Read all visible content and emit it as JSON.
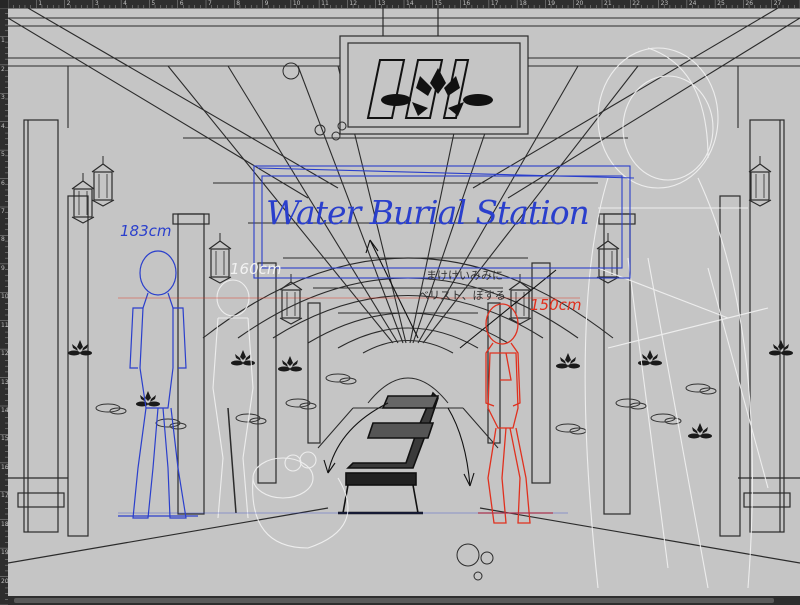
{
  "ruler": {
    "top_labels": [
      "1",
      "2",
      "3",
      "4",
      "5",
      "6",
      "7",
      "8",
      "9",
      "10",
      "11",
      "12",
      "13",
      "14",
      "15",
      "16",
      "17",
      "18",
      "19",
      "20",
      "21",
      "22",
      "23",
      "24",
      "25",
      "26",
      "27"
    ],
    "left_labels": [
      "1",
      "2",
      "3",
      "4",
      "5",
      "6",
      "7",
      "8",
      "9",
      "10",
      "11",
      "12",
      "13",
      "14",
      "15",
      "16",
      "17",
      "18",
      "19",
      "20"
    ]
  },
  "annotations": {
    "station_name": "Water Burial Station",
    "height_blue": "183cm",
    "height_white": "160cm",
    "height_red": "150cm",
    "note_line1": "まけけいみみに",
    "note_line2": "ベリスト、ぼする"
  },
  "colors": {
    "canvas": "#c5c5c5",
    "line": "#2b2b2b",
    "blue_sketch": "#2a3fcc",
    "red_sketch": "#e0301e",
    "white_sketch": "#f2f2f2",
    "ruler_bg": "#2e2e2e"
  },
  "icons": [
    "lotus-sign-icon",
    "lotus-wall-icon",
    "bench-icon",
    "lantern-icon"
  ]
}
